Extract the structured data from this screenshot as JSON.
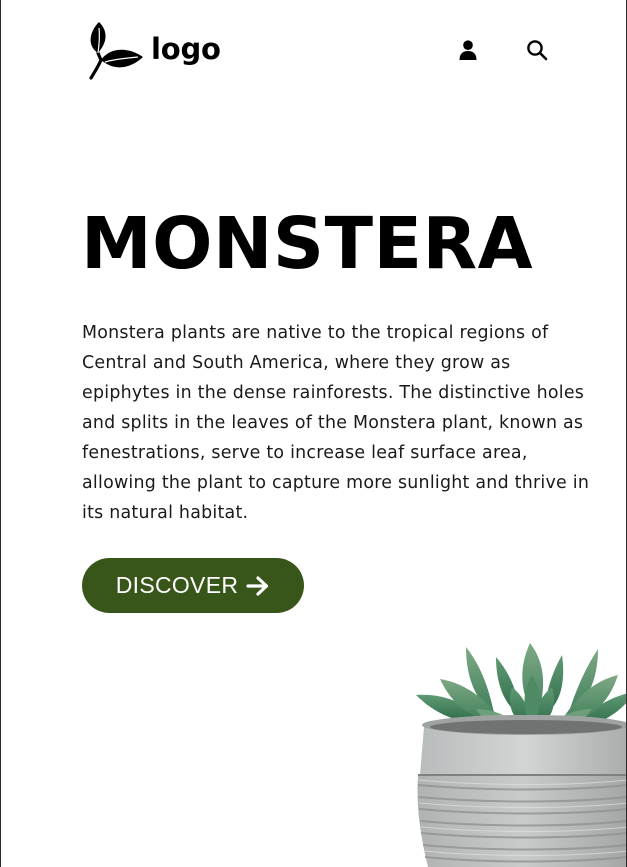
{
  "header": {
    "logo_text": "logo",
    "logo_icon": "leaf-icon",
    "user_icon": "user-icon",
    "search_icon": "search-icon"
  },
  "hero": {
    "title": "MONSTERA",
    "description": "Monstera plants are native to the tropical regions of Central and South America, where they grow as epiphytes in the dense rainforests. The distinctive holes and splits in the leaves of the Monstera plant, known as fenestrations, serve to increase leaf surface area, allowing the plant to capture more sunlight and thrive in its natural habitat.",
    "cta_label": "DISCOVER",
    "cta_icon": "arrow-right-icon"
  },
  "image": {
    "subject": "succulent-plant-in-concrete-pot"
  },
  "colors": {
    "accent": "#39561a",
    "text": "#000000",
    "background": "#ffffff"
  }
}
